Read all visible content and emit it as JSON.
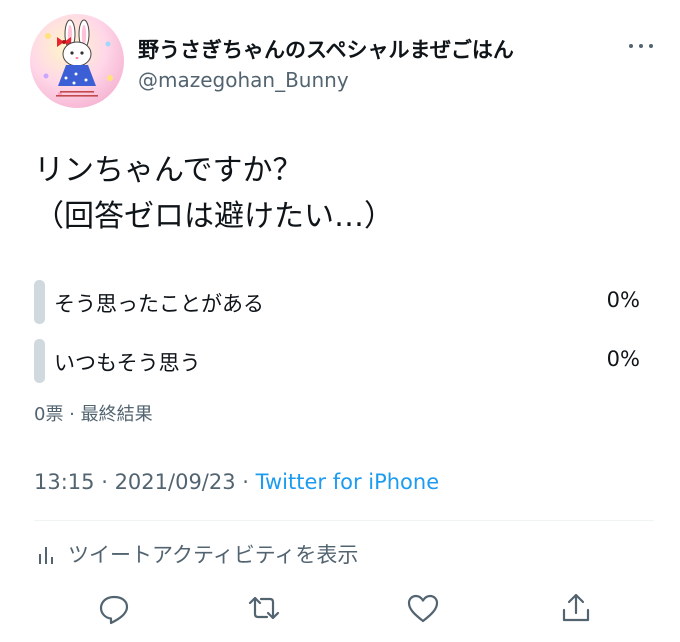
{
  "author": {
    "display_name": "野うさぎちゃんのスペシャルまぜごはん",
    "handle": "@mazegohan_Bunny",
    "avatar": "bunny-avatar"
  },
  "tweet": {
    "text": "リンちゃんですか？\n（回答ゼロは避けたい…）"
  },
  "poll": {
    "options": [
      {
        "label": "そう思ったことがある",
        "percent": "0%"
      },
      {
        "label": "いつもそう思う",
        "percent": "0%"
      }
    ],
    "summary": "0票 · 最終結果"
  },
  "meta": {
    "time": "13:15",
    "separator": " · ",
    "date": "2021/09/23",
    "source": "Twitter for iPhone"
  },
  "activity": {
    "label": "ツイートアクティビティを表示",
    "icon": "bar-chart-icon"
  },
  "actions": [
    {
      "icon": "reply-icon"
    },
    {
      "icon": "retweet-icon"
    },
    {
      "icon": "like-icon"
    },
    {
      "icon": "share-icon"
    }
  ],
  "colors": {
    "text": "#0f1419",
    "secondary": "#536471",
    "link": "#1d9bf0",
    "poll_bar": "#cfd9de",
    "divider": "#eff3f4"
  }
}
